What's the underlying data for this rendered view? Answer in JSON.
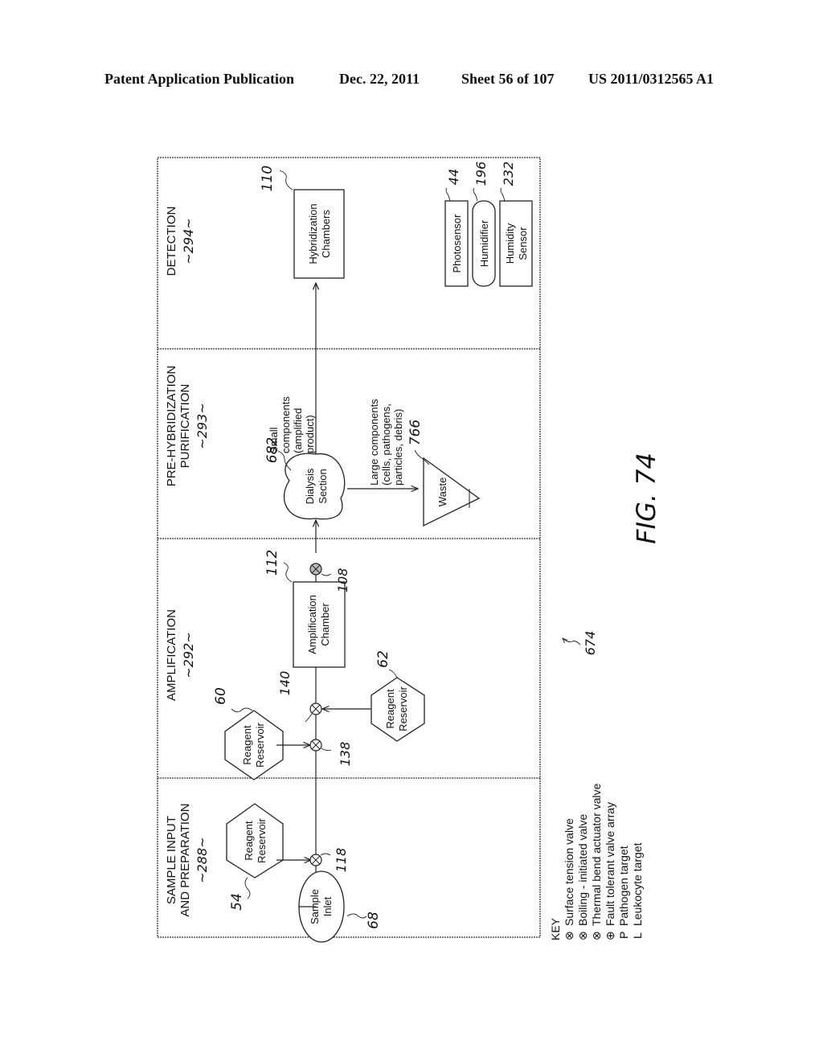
{
  "header": {
    "publication_type": "Patent Application Publication",
    "date": "Dec. 22, 2011",
    "sheet": "Sheet 56 of 107",
    "pub_number": "US 2011/0312565 A1"
  },
  "figure": {
    "label": "FIG. 74",
    "ref": "674",
    "stages": [
      {
        "line1": "SAMPLE INPUT",
        "line2": "AND PREPARATION",
        "ref": "~288~"
      },
      {
        "line1": "AMPLIFICATION",
        "line2": "",
        "ref": "~292~"
      },
      {
        "line1": "PRE-HYBRIDIZATION",
        "line2": "PURIFICATION",
        "ref": "~293~"
      },
      {
        "line1": "DETECTION",
        "line2": "",
        "ref": "~294~"
      }
    ],
    "components": {
      "sample_inlet": {
        "line1": "Sample",
        "line2": "Inlet",
        "ref": "68"
      },
      "reagent_54": {
        "line1": "Reagent",
        "line2": "Reservoir",
        "ref": "54"
      },
      "reagent_60": {
        "line1": "Reagent",
        "line2": "Reservoir",
        "ref": "60"
      },
      "reagent_62": {
        "line1": "Reagent",
        "line2": "Reservoir",
        "ref": "62"
      },
      "amplification_chamber": {
        "line1": "Amplification",
        "line2": "Chamber",
        "ref": "112"
      },
      "dialysis_section": {
        "line1": "Dialysis",
        "line2": "Section",
        "ref": "682"
      },
      "waste": {
        "label": "Waste",
        "ref": "766"
      },
      "hybridization_chambers": {
        "line1": "Hybridization",
        "line2": "Chambers",
        "ref": "110"
      },
      "photosensor": {
        "label": "Photosensor",
        "ref": "44"
      },
      "humidifier": {
        "label": "Humidifier",
        "ref": "196"
      },
      "humidity_sensor": {
        "line1": "Humidity",
        "line2": "Sensor",
        "ref": "232"
      }
    },
    "valves": {
      "v118": "118",
      "v138": "138",
      "v140": "140",
      "v108": "108"
    },
    "annotations": {
      "small": [
        "Small",
        "components",
        "(amplified",
        "product)"
      ],
      "large": [
        "Large components",
        "(cells, pathogens,",
        "particles, debris)"
      ]
    }
  },
  "key": {
    "title": "KEY",
    "items": [
      {
        "symbol": "⊗",
        "label": "Surface tension valve"
      },
      {
        "symbol": "⊗",
        "label": "Boiling - initiated valve"
      },
      {
        "symbol": "⊗",
        "label": "Thermal bend actuator valve"
      },
      {
        "symbol": "⊕",
        "label": "Fault tolerant valve array"
      },
      {
        "symbol": "P",
        "label": "Pathogen target"
      },
      {
        "symbol": "L",
        "label": "Leukocyte target"
      }
    ]
  }
}
